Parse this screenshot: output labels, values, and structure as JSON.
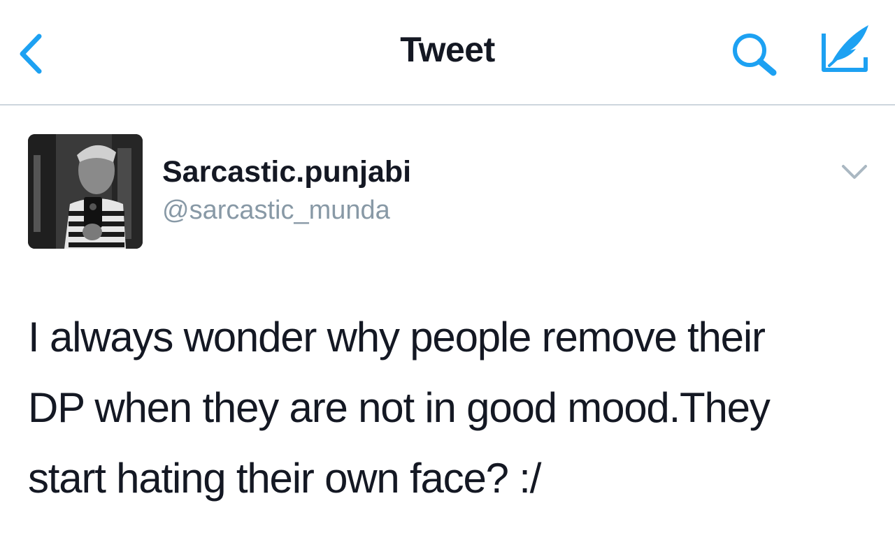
{
  "navbar": {
    "title": "Tweet",
    "accent_color": "#1da1f2",
    "back_icon": "chevron-left-icon",
    "search_icon": "search-icon",
    "compose_icon": "compose-tweet-icon"
  },
  "tweet": {
    "display_name": "Sarcastic.punjabi",
    "handle": "@sarcastic_munda",
    "avatar_icon": "profile-photo",
    "more_icon": "chevron-down-icon",
    "text_lines": [
      "I always wonder why people remove their",
      "DP when they are not in good mood.They",
      "start hating their own face? :/"
    ]
  }
}
